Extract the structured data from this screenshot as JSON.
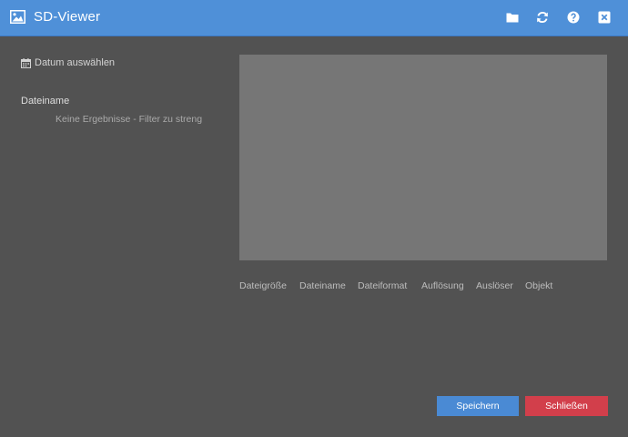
{
  "window": {
    "title": "SD-Viewer",
    "icons": [
      "image-icon",
      "folder-icon",
      "refresh-icon",
      "help-icon",
      "close-icon"
    ]
  },
  "sidebar": {
    "date_picker_label": "Datum auswählen",
    "filename_heading": "Dateiname",
    "empty_message": "Keine Ergebnisse - Filter zu streng"
  },
  "details": {
    "columns": [
      "Dateigröße",
      "Dateiname",
      "Dateiformat",
      "Auflösung",
      "Auslöser",
      "Objekt"
    ]
  },
  "footer": {
    "save_label": "Speichern",
    "close_label": "Schließen"
  },
  "colors": {
    "titlebar": "#4f90d8",
    "background": "#525252",
    "preview": "#767676",
    "save_button": "#4a8ad4",
    "close_button": "#d23f4b"
  }
}
